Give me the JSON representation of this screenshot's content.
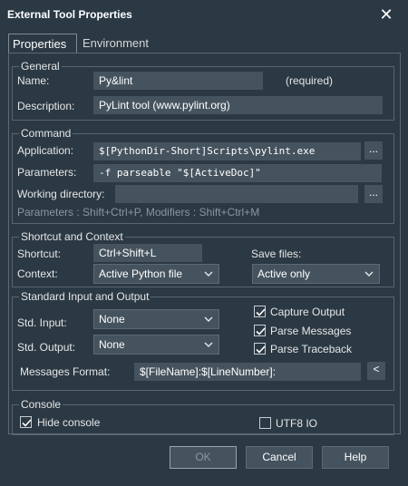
{
  "window": {
    "title": "External Tool Properties"
  },
  "tabs": [
    {
      "label": "Properties"
    },
    {
      "label": "Environment"
    }
  ],
  "general": {
    "legend": "General",
    "name_label": "Name:",
    "name_value": "Py&lint",
    "required_note": "(required)",
    "description_label": "Description:",
    "description_value": "PyLint tool (www.pylint.org)"
  },
  "command": {
    "legend": "Command",
    "application_label": "Application:",
    "application_value": "$[PythonDir-Short]Scripts\\pylint.exe",
    "parameters_label": "Parameters:",
    "parameters_value": "-f parseable \"$[ActiveDoc]\"",
    "working_dir_label": "Working directory:",
    "working_dir_value": "",
    "browse_label": "...",
    "hint": "Parameters : Shift+Ctrl+P, Modifiers : Shift+Ctrl+M"
  },
  "shortcut": {
    "legend": "Shortcut and Context",
    "shortcut_label": "Shortcut:",
    "shortcut_value": "Ctrl+Shift+L",
    "save_label": "Save files:",
    "context_label": "Context:",
    "context_value": "Active Python file",
    "save_value": "Active only"
  },
  "stdio": {
    "legend": "Standard Input and Output",
    "input_label": "Std. Input:",
    "input_value": "None",
    "output_label": "Std. Output:",
    "output_value": "None",
    "capture_label": "Capture Output",
    "parse_messages_label": "Parse Messages",
    "parse_traceback_label": "Parse Traceback",
    "format_label": "Messages Format:",
    "format_value": "$[FileName]:$[LineNumber]:",
    "insert_label": "<",
    "capture_checked": true,
    "parse_messages_checked": true,
    "parse_traceback_checked": true
  },
  "console": {
    "legend": "Console",
    "hide_label": "Hide console",
    "utf8_label": "UTF8 IO",
    "hide_checked": true,
    "utf8_checked": false
  },
  "buttons": {
    "ok": "OK",
    "cancel": "Cancel",
    "help": "Help"
  },
  "colors": {
    "background": "#2b3944",
    "field": "#45535e",
    "text": "#e6e6e6",
    "hint": "#8b969e"
  }
}
